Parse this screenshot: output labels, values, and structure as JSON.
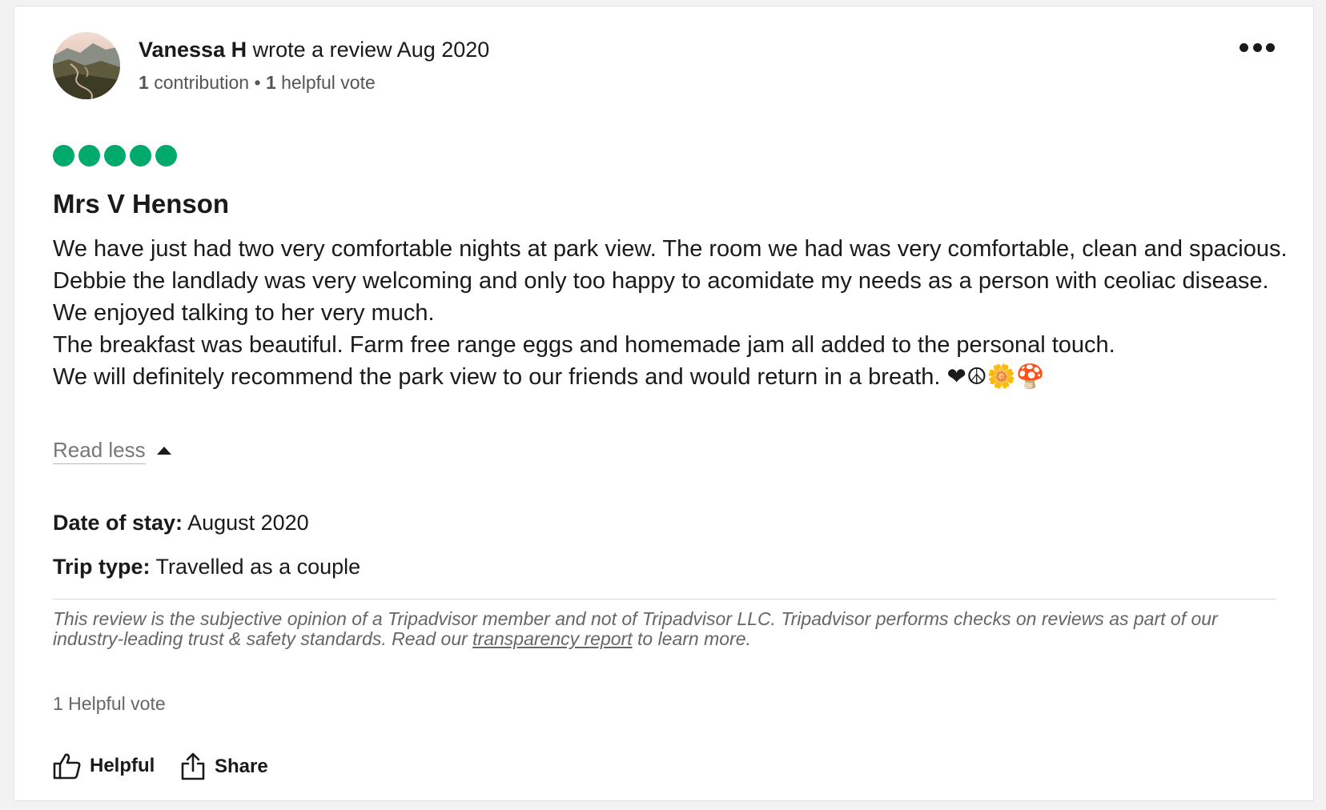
{
  "review": {
    "user": {
      "name": "Vanessa H",
      "action_text": "wrote a review Aug 2020",
      "contribution_count": "1",
      "contribution_label": "contribution",
      "separator": "•",
      "helpful_count": "1",
      "helpful_label": "helpful vote",
      "avatar_icon": "landscape-avatar"
    },
    "more_icon": "ellipsis-icon",
    "rating": {
      "value": 5,
      "max": 5,
      "color": "#00aa6c"
    },
    "title": "Mrs V Henson",
    "body": [
      "We have just had two very comfortable nights at park view. The room we had was very comfortable, clean and spacious. Debbie the landlady was very welcoming and only too happy to acomidate my needs as a person with ceoliac disease.",
      "We enjoyed talking to her very much.",
      "The breakfast was beautiful. Farm free range eggs and homemade jam all added to the personal touch.",
      "We will definitely recommend the park view to our friends and would return in a breath. ❤☮🌼🍄"
    ],
    "read_less": "Read less",
    "date_of_stay": {
      "label": "Date of stay:",
      "value": "August 2020"
    },
    "trip_type": {
      "label": "Trip type:",
      "value": "Travelled as a couple"
    },
    "disclaimer": {
      "before": "This review is the subjective opinion of a Tripadvisor member and not of Tripadvisor LLC. Tripadvisor performs checks on reviews as part of our industry-leading trust & safety standards. Read our ",
      "link": "transparency report",
      "after": " to learn more."
    },
    "helpful_votes_text": "1 Helpful vote",
    "actions": {
      "helpful": {
        "label": "Helpful",
        "icon": "thumbs-up-icon"
      },
      "share": {
        "label": "Share",
        "icon": "share-icon"
      }
    }
  }
}
